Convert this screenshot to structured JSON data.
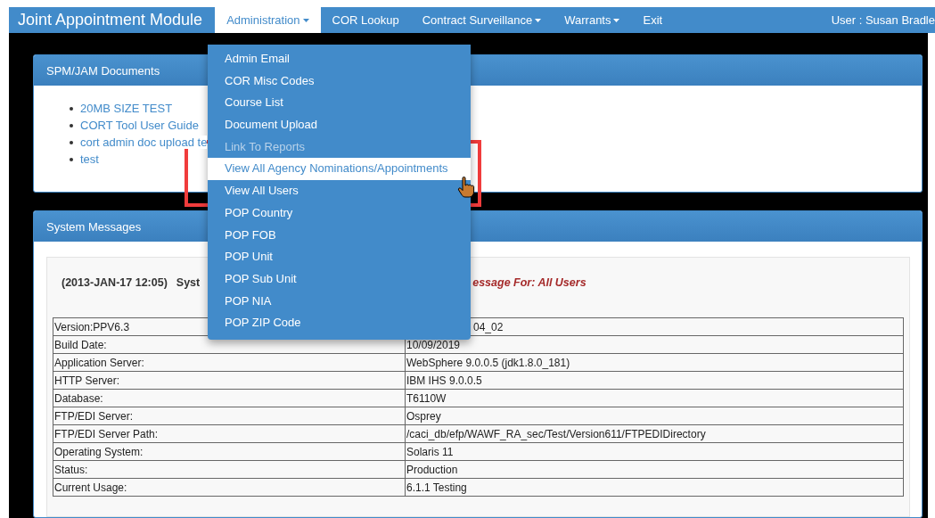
{
  "navbar": {
    "brand": "Joint Appointment Module",
    "items": [
      {
        "label": "Administration",
        "caret": true,
        "selected": true
      },
      {
        "label": "COR Lookup",
        "caret": false,
        "selected": false
      },
      {
        "label": "Contract Surveillance",
        "caret": true,
        "selected": false
      },
      {
        "label": "Warrants",
        "caret": true,
        "selected": false
      },
      {
        "label": "Exit",
        "caret": false,
        "selected": false
      }
    ],
    "user": "User : Susan Bradle"
  },
  "dropdown": {
    "items": [
      {
        "label": "Admin Email",
        "disabled": false,
        "selected": false
      },
      {
        "label": "COR Misc Codes",
        "disabled": false,
        "selected": false
      },
      {
        "label": "Course List",
        "disabled": false,
        "selected": false
      },
      {
        "label": "Document Upload",
        "disabled": false,
        "selected": false
      },
      {
        "label": "Link To Reports",
        "disabled": true,
        "selected": false
      },
      {
        "label": "View All Agency Nominations/Appointments",
        "disabled": false,
        "selected": true
      },
      {
        "label": "View All Users",
        "disabled": false,
        "selected": false
      },
      {
        "label": "POP Country",
        "disabled": false,
        "selected": false
      },
      {
        "label": "POP FOB",
        "disabled": false,
        "selected": false
      },
      {
        "label": "POP Unit",
        "disabled": false,
        "selected": false
      },
      {
        "label": "POP Sub Unit",
        "disabled": false,
        "selected": false
      },
      {
        "label": "POP NIA",
        "disabled": false,
        "selected": false
      },
      {
        "label": "POP ZIP Code",
        "disabled": false,
        "selected": false
      }
    ]
  },
  "documents_panel": {
    "title": "SPM/JAM Documents",
    "links": [
      "20MB SIZE TEST",
      "CORT Tool User Guide",
      "cort admin doc upload te",
      "test"
    ]
  },
  "messages_panel": {
    "title": "System Messages",
    "timestamp": "(2013-JAN-17 12:05)",
    "subject": "Syst",
    "audience": "essage For: All Users",
    "rows": [
      {
        "label": "Version:PPV6.3",
        "value": "04_02"
      },
      {
        "label": "Build Date:",
        "value": "10/09/2019"
      },
      {
        "label": "Application Server:",
        "value": "WebSphere 9.0.0.5 (jdk1.8.0_181)"
      },
      {
        "label": "HTTP Server:",
        "value": "IBM IHS 9.0.0.5"
      },
      {
        "label": "Database:",
        "value": "T6110W"
      },
      {
        "label": "FTP/EDI Server:",
        "value": "Osprey"
      },
      {
        "label": "FTP/EDI Server Path:",
        "value": "/caci_db/efp/WAWF_RA_sec/Test/Version611/FTPEDIDirectory"
      },
      {
        "label": "Operating System:",
        "value": "Solaris 11"
      },
      {
        "label": "Status:",
        "value": "Production"
      },
      {
        "label": "Current Usage:",
        "value": "6.1.1 Testing"
      }
    ]
  }
}
